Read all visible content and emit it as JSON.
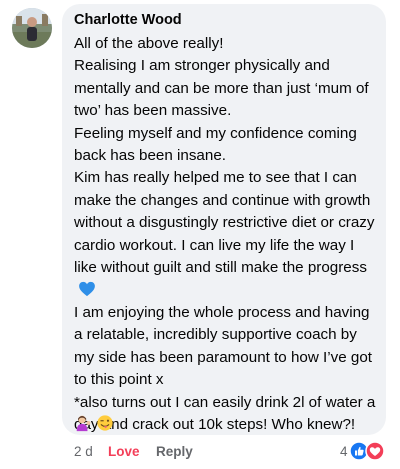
{
  "comment": {
    "author": "Charlotte Wood",
    "paragraphs": [
      "All of the above really!",
      "Realising I am stronger physically and mentally and can be more than just ‘mum of two’ has been massive.",
      "Feeling myself and my confidence coming back has been insane.",
      "Kim has really helped me to see that I can make the changes and continue with growth without a disgustingly restrictive diet or crazy cardio workout. I can live my life the way I like without guilt and still make the progress",
      "I am enjoying the whole process and having a relatable, incredibly supportive coach by my side has been paramount to how I’ve got to this point x",
      "*also turns out I can easily drink 2l of water a day and crack out 10k steps! Who knew?!"
    ],
    "emojis": [
      "person-tipping-hand-emoji",
      "winking-face-with-tongue-emoji"
    ],
    "heart_color": "#2f8fe8"
  },
  "footer": {
    "time": "2 d",
    "love_label": "Love",
    "reply_label": "Reply",
    "reaction_count": "4",
    "love_color": "#f33e58",
    "like_color": "#1877f2"
  }
}
